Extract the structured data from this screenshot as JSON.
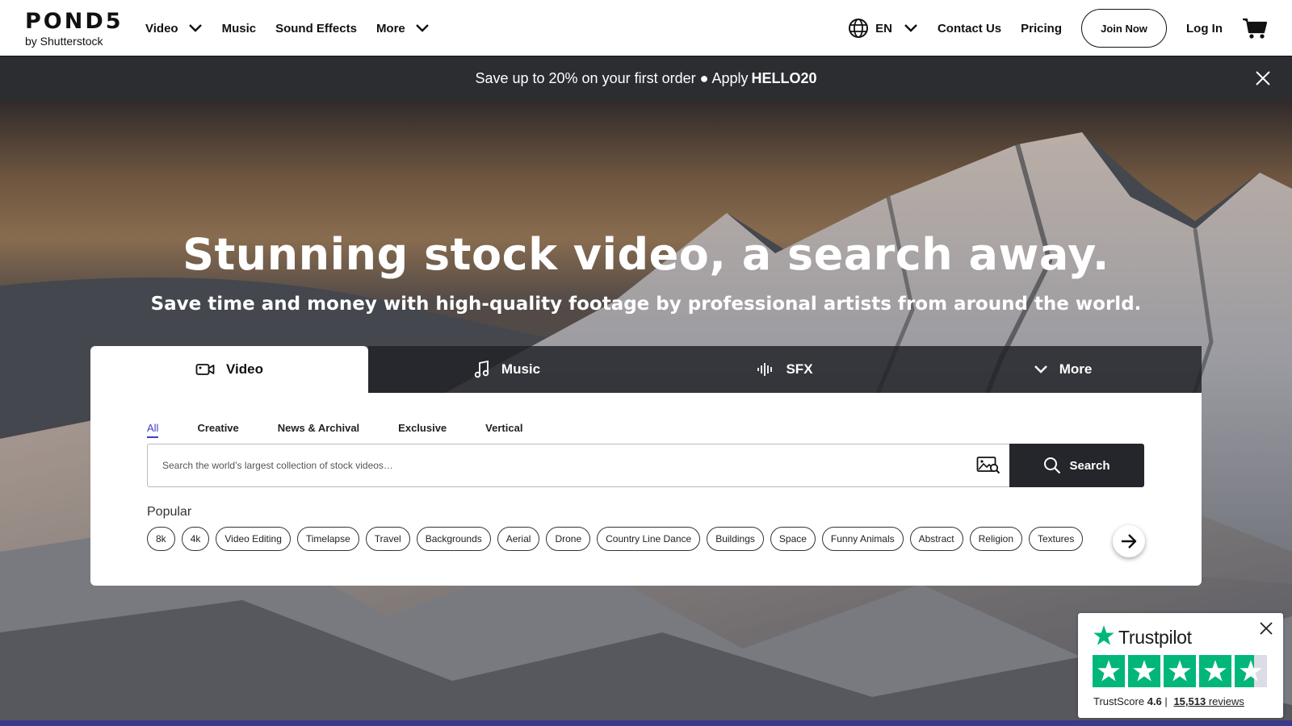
{
  "brand": {
    "logo": "POND5",
    "tagline": "by Shutterstock"
  },
  "nav": {
    "items": [
      {
        "label": "Video",
        "has_dropdown": true
      },
      {
        "label": "Music",
        "has_dropdown": false
      },
      {
        "label": "Sound Effects",
        "has_dropdown": false
      },
      {
        "label": "More",
        "has_dropdown": true
      }
    ],
    "language": "EN",
    "contact": "Contact Us",
    "pricing": "Pricing",
    "join": "Join Now",
    "login": "Log In"
  },
  "promo": {
    "text": "Save up to 20% on your first order ● Apply",
    "code": "HELLO20"
  },
  "hero": {
    "title": "Stunning stock video, a search away.",
    "subtitle": "Save time and money with high-quality footage by professional artists from around the world."
  },
  "search": {
    "tabs": [
      {
        "label": "Video",
        "icon": "video-camera-icon",
        "active": true
      },
      {
        "label": "Music",
        "icon": "music-note-icon",
        "active": false
      },
      {
        "label": "SFX",
        "icon": "sound-wave-icon",
        "active": false
      },
      {
        "label": "More",
        "icon": "chevron-down-icon",
        "active": false
      }
    ],
    "subtabs": [
      "All",
      "Creative",
      "News & Archival",
      "Exclusive",
      "Vertical"
    ],
    "placeholder": "Search the world’s largest collection of stock videos…",
    "button": "Search",
    "popular_label": "Popular",
    "popular": [
      "8k",
      "4k",
      "Video Editing",
      "Timelapse",
      "Travel",
      "Backgrounds",
      "Aerial",
      "Drone",
      "Country Line Dance",
      "Buildings",
      "Space",
      "Funny Animals",
      "Abstract",
      "Religion",
      "Textures"
    ]
  },
  "trustpilot": {
    "name": "Trustpilot",
    "score_label": "TrustScore",
    "score": "4.6",
    "separator": "|",
    "reviews_count": "15,513",
    "reviews_label": "reviews",
    "stars": 4.6
  },
  "colors": {
    "promo_bg": "#2b2d31",
    "accent": "#3d3dc8",
    "trust_green": "#00b67a",
    "search_btn": "#24262b"
  }
}
